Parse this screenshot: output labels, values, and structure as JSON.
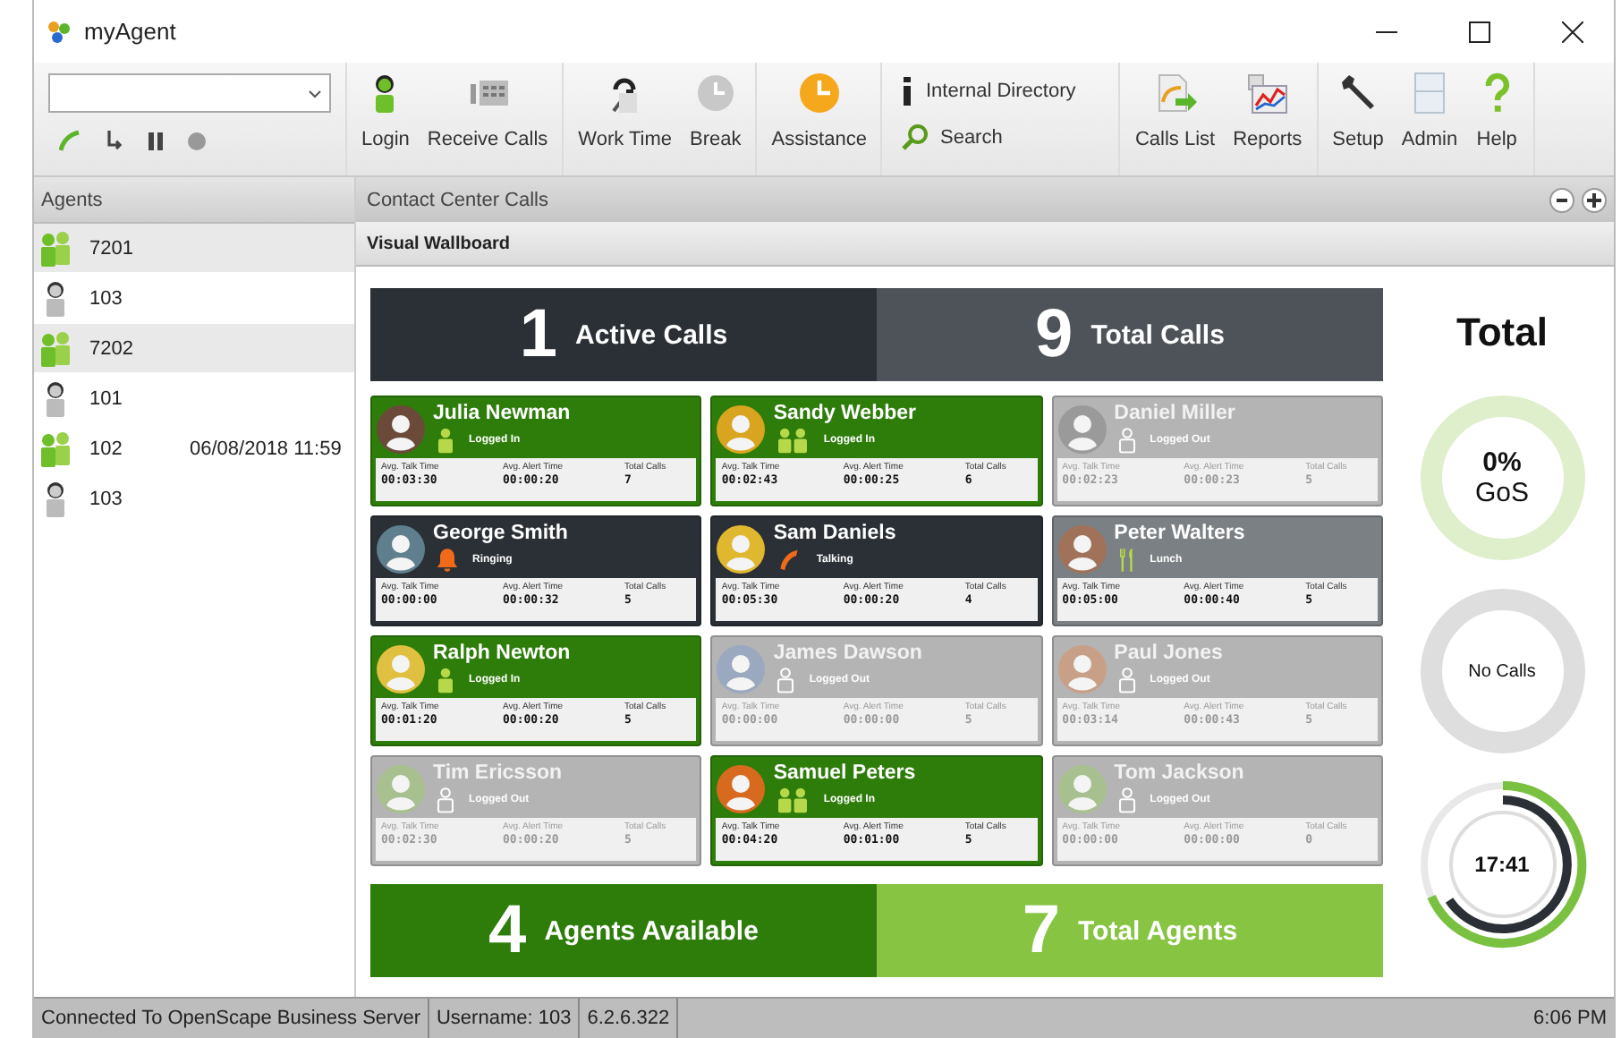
{
  "window": {
    "title": "myAgent"
  },
  "toolbar": {
    "groups": [
      [
        {
          "label": "Login"
        },
        {
          "label": "Receive Calls"
        }
      ],
      [
        {
          "label": "Work Time"
        },
        {
          "label": "Break"
        }
      ],
      [
        {
          "label": "Assistance"
        }
      ]
    ],
    "links": [
      {
        "label": "Internal Directory"
      },
      {
        "label": "Search"
      }
    ],
    "groups2": [
      [
        {
          "label": "Calls List"
        },
        {
          "label": "Reports"
        }
      ],
      [
        {
          "label": "Setup"
        },
        {
          "label": "Admin"
        },
        {
          "label": "Help"
        }
      ]
    ]
  },
  "agents": {
    "title": "Agents",
    "items": [
      {
        "number": "7201",
        "available": true,
        "selected": true
      },
      {
        "number": "103",
        "available": false,
        "selected": false
      },
      {
        "number": "7202",
        "available": true,
        "selected": true
      },
      {
        "number": "101",
        "available": false,
        "selected": false
      },
      {
        "number": "102",
        "time": "06/08/2018 11:59",
        "available": true,
        "selected": false
      },
      {
        "number": "103",
        "available": false,
        "selected": false
      }
    ]
  },
  "panel": {
    "title": "Contact Center Calls",
    "subtitle": "Visual Wallboard"
  },
  "top_stats": [
    {
      "value": "1",
      "label": "Active Calls",
      "color": "#2a3036"
    },
    {
      "value": "9",
      "label": "Total Calls",
      "color": "#4d5358"
    }
  ],
  "cards": [
    {
      "name": "Julia Newman",
      "kind": "logged-in",
      "status": {
        "kind": "person",
        "text": "Logged In"
      },
      "color": "#6b4a3a",
      "stats": [
        {
          "label": "Avg. Talk Time",
          "value": "00:03:30"
        },
        {
          "label": "Avg. Alert Time",
          "value": "00:00:20"
        },
        {
          "label": "Total Calls",
          "value": "7"
        }
      ]
    },
    {
      "name": "Sandy Webber",
      "kind": "logged-in",
      "status": {
        "kind": "pair",
        "text": "Logged In"
      },
      "color": "#d9a520",
      "stats": [
        {
          "label": "Avg. Talk Time",
          "value": "00:02:43"
        },
        {
          "label": "Avg. Alert Time",
          "value": "00:00:25"
        },
        {
          "label": "Total Calls",
          "value": "6"
        }
      ]
    },
    {
      "name": "Daniel Miller",
      "kind": "logged-out",
      "status": {
        "kind": "outline",
        "text": "Logged Out"
      },
      "color": "#9a9a9a",
      "stats": [
        {
          "label": "Avg. Talk Time",
          "value": "00:02:23"
        },
        {
          "label": "Avg. Alert Time",
          "value": "00:00:23"
        },
        {
          "label": "Total Calls",
          "value": "5"
        }
      ]
    },
    {
      "name": "George Smith",
      "kind": "ringing",
      "status": {
        "kind": "bell",
        "text": "Ringing"
      },
      "color": "#5f7f8f",
      "stats": [
        {
          "label": "Avg. Talk Time",
          "value": "00:00:00"
        },
        {
          "label": "Avg. Alert Time",
          "value": "00:00:32"
        },
        {
          "label": "Total Calls",
          "value": "5"
        }
      ]
    },
    {
      "name": "Sam Daniels",
      "kind": "talking",
      "status": {
        "kind": "handset",
        "text": "Talking"
      },
      "color": "#e0b830",
      "stats": [
        {
          "label": "Avg. Talk Time",
          "value": "00:05:30"
        },
        {
          "label": "Avg. Alert Time",
          "value": "00:00:20"
        },
        {
          "label": "Total Calls",
          "value": "4"
        }
      ]
    },
    {
      "name": "Peter Walters",
      "kind": "lunch",
      "status": {
        "kind": "cutlery",
        "text": "Lunch"
      },
      "color": "#a0725a",
      "stats": [
        {
          "label": "Avg. Talk Time",
          "value": "00:05:00"
        },
        {
          "label": "Avg. Alert Time",
          "value": "00:00:40"
        },
        {
          "label": "Total Calls",
          "value": "5"
        }
      ]
    },
    {
      "name": "Ralph Newton",
      "kind": "logged-in",
      "status": {
        "kind": "person",
        "text": "Logged In"
      },
      "color": "#e0c040",
      "stats": [
        {
          "label": "Avg. Talk Time",
          "value": "00:01:20"
        },
        {
          "label": "Avg. Alert Time",
          "value": "00:00:20"
        },
        {
          "label": "Total Calls",
          "value": "5"
        }
      ]
    },
    {
      "name": "James Dawson",
      "kind": "logged-out",
      "status": {
        "kind": "outline",
        "text": "Logged Out"
      },
      "color": "#9aa8c0",
      "stats": [
        {
          "label": "Avg. Talk Time",
          "value": "00:00:00"
        },
        {
          "label": "Avg. Alert Time",
          "value": "00:00:00"
        },
        {
          "label": "Total Calls",
          "value": "5"
        }
      ]
    },
    {
      "name": "Paul Jones",
      "kind": "logged-out",
      "status": {
        "kind": "outline",
        "text": "Logged Out"
      },
      "color": "#c8a088",
      "stats": [
        {
          "label": "Avg. Talk Time",
          "value": "00:03:14"
        },
        {
          "label": "Avg. Alert Time",
          "value": "00:00:43"
        },
        {
          "label": "Total Calls",
          "value": "5"
        }
      ]
    },
    {
      "name": "Tim Ericsson",
      "kind": "logged-out",
      "status": {
        "kind": "outline",
        "text": "Logged Out"
      },
      "color": "#a8c090",
      "stats": [
        {
          "label": "Avg. Talk Time",
          "value": "00:02:30"
        },
        {
          "label": "Avg. Alert Time",
          "value": "00:00:20"
        },
        {
          "label": "Total Calls",
          "value": "5"
        }
      ]
    },
    {
      "name": "Samuel Peters",
      "kind": "logged-in",
      "status": {
        "kind": "pair",
        "text": "Logged In"
      },
      "color": "#d86a20",
      "stats": [
        {
          "label": "Avg. Talk Time",
          "value": "00:04:20"
        },
        {
          "label": "Avg. Alert Time",
          "value": "00:01:00"
        },
        {
          "label": "Total Calls",
          "value": "5"
        }
      ]
    },
    {
      "name": "Tom Jackson",
      "kind": "logged-out",
      "status": {
        "kind": "outline",
        "text": "Logged Out"
      },
      "color": "#a8c090",
      "stats": [
        {
          "label": "Avg. Talk Time",
          "value": "00:00:00"
        },
        {
          "label": "Avg. Alert Time",
          "value": "00:00:00"
        },
        {
          "label": "Total Calls",
          "value": "0"
        }
      ]
    }
  ],
  "bottom_stats": [
    {
      "value": "4",
      "label": "Agents Available",
      "color": "#2e7d0a"
    },
    {
      "value": "7",
      "label": "Total Agents",
      "color": "#86c442"
    }
  ],
  "summary": {
    "title": "Total",
    "gos_value": "0%",
    "gos_label": "GoS",
    "no_calls": "No Calls",
    "time": "17:41"
  },
  "status_bar": {
    "connection": "Connected To OpenScape Business Server",
    "username": "Username: 103",
    "version": "6.2.6.322",
    "clock": "6:06 PM"
  }
}
